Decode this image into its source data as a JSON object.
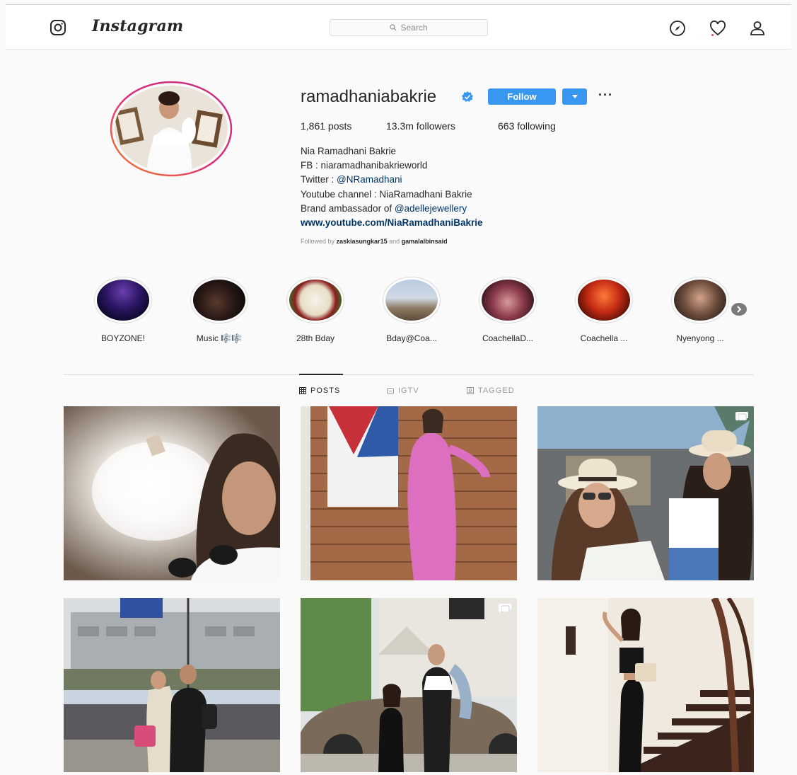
{
  "header": {
    "wordmark": "Instagram",
    "search_placeholder": "Search",
    "icons": [
      "instagram-glyph-icon",
      "compass-icon",
      "heart-icon",
      "profile-icon"
    ]
  },
  "profile": {
    "username": "ramadhaniabakrie",
    "verified": true,
    "follow_label": "Follow",
    "more_label": "···",
    "stats": {
      "posts": "1,861 posts",
      "followers": "13.3m followers",
      "following": "663 following"
    },
    "bio": {
      "full_name": "Nia Ramadhani Bakrie",
      "fb_line": "FB : niaramadhanibakrieworld",
      "twitter_prefix": "Twitter : ",
      "twitter_handle": "@NRamadhani",
      "youtube_line": "Youtube channel : NiaRamadhani Bakrie",
      "brand_prefix": "Brand ambassador of ",
      "brand_handle": "@adellejewellery",
      "website": "www.youtube.com/NiaRamadhaniBakrie"
    },
    "followed_by": {
      "prefix": "Followed by ",
      "user1": "zaskiasungkar15",
      "conj": " and ",
      "user2": "gamalalbinsaid"
    }
  },
  "highlights": [
    {
      "label": "BOYZONE!"
    },
    {
      "label": "Music 🎼🎼"
    },
    {
      "label": "28th Bday"
    },
    {
      "label": "Bday@Coa..."
    },
    {
      "label": "CoachellaD..."
    },
    {
      "label": "Coachella ..."
    },
    {
      "label": "Nyenyong ..."
    }
  ],
  "tabs": [
    {
      "label": "POSTS",
      "active": true
    },
    {
      "label": "IGTV",
      "active": false
    },
    {
      "label": "TAGGED",
      "active": false
    }
  ],
  "colors": {
    "accent": "#3897f0",
    "verified": "#3897f0",
    "link": "#003569",
    "ring_start": "#f58529",
    "ring_end": "#dd2a7b"
  }
}
